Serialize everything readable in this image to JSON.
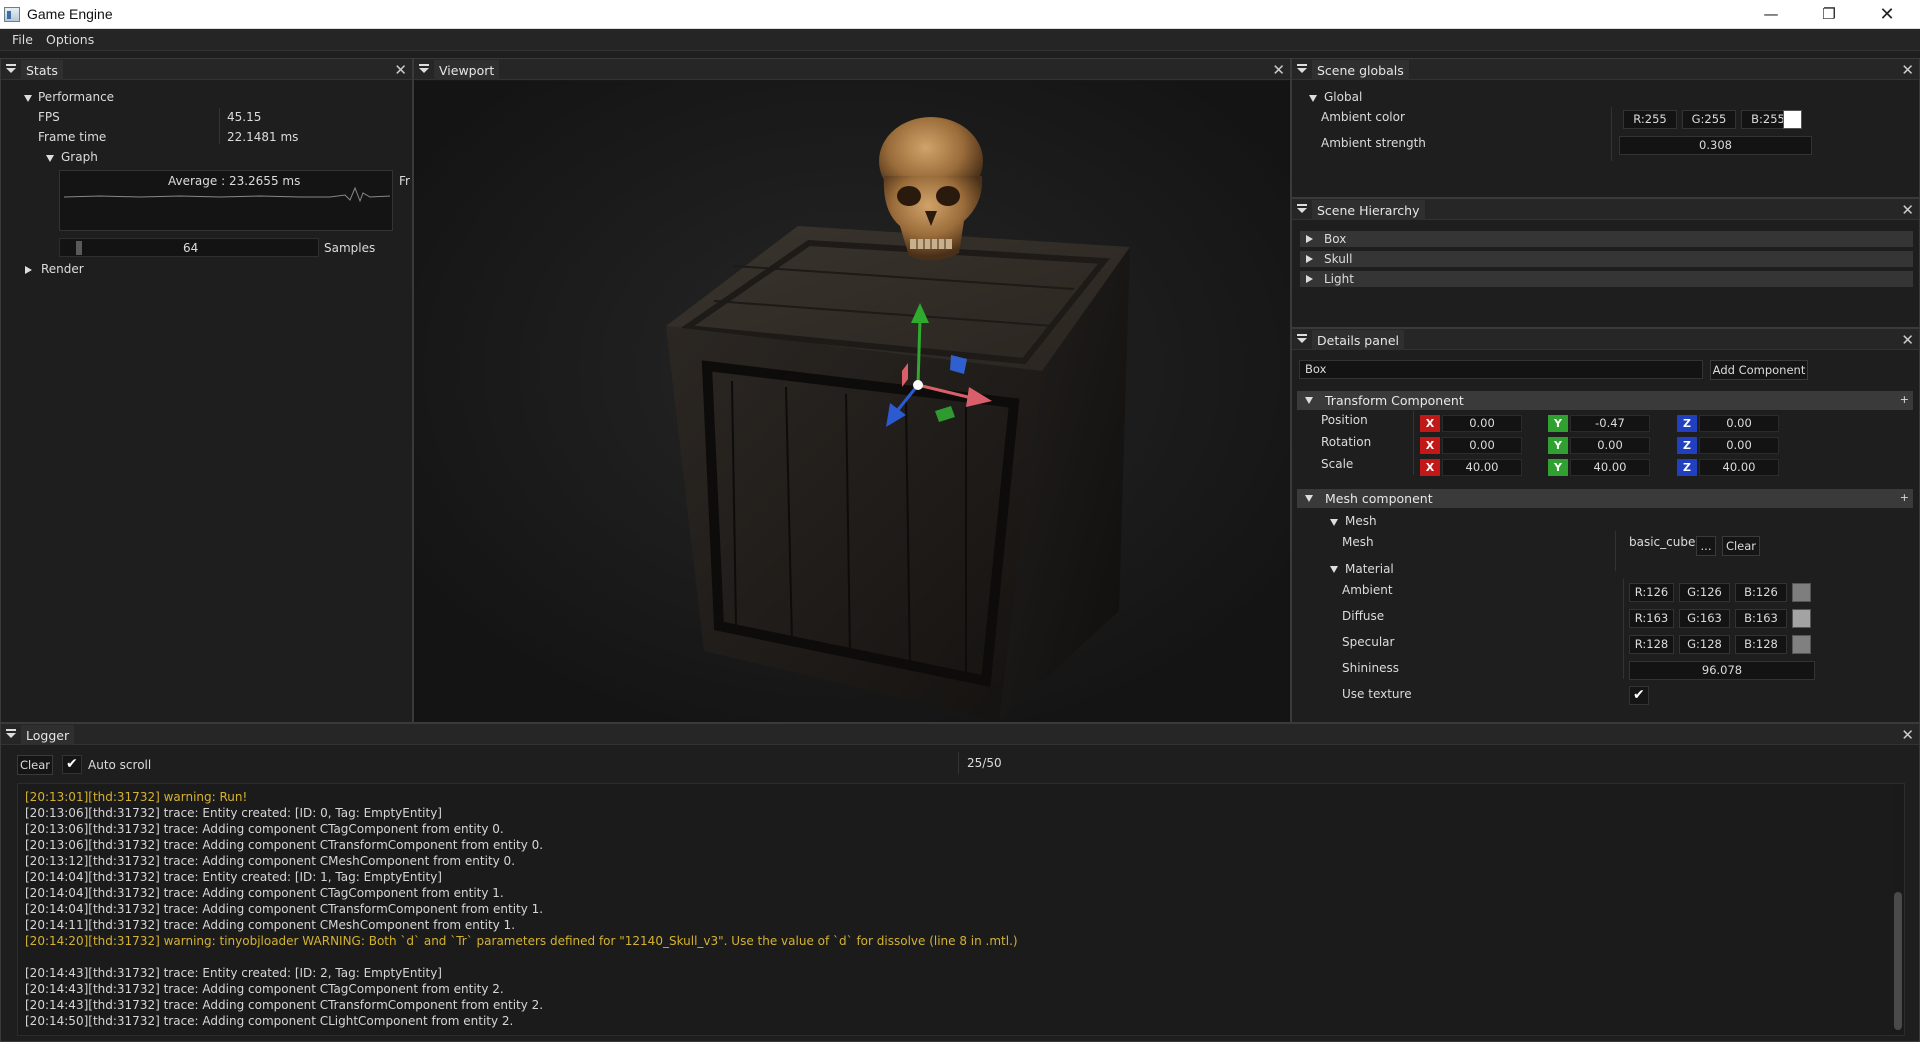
{
  "window": {
    "title": "Game Engine"
  },
  "menu": [
    "File",
    "Options"
  ],
  "stats": {
    "tab": "Stats",
    "performance_label": "Performance",
    "fps_label": "FPS",
    "fps_value": "45.15",
    "frame_time_label": "Frame time",
    "frame_time_value": "22.1481 ms",
    "graph_label": "Graph",
    "graph_average": "Average : 23.2655 ms",
    "graph_side_label": "Fr",
    "samples_value": "64",
    "samples_label": "Samples",
    "render_label": "Render"
  },
  "viewport": {
    "tab": "Viewport"
  },
  "scene_globals": {
    "tab": "Scene globals",
    "global_label": "Global",
    "ambient_color_label": "Ambient color",
    "ambient_r": "R:255",
    "ambient_g": "G:255",
    "ambient_b": "B:255",
    "ambient_swatch": "#ffffff",
    "ambient_strength_label": "Ambient strength",
    "ambient_strength_value": "0.308"
  },
  "hierarchy": {
    "tab": "Scene Hierarchy",
    "items": [
      "Box",
      "Skull",
      "Light"
    ]
  },
  "details": {
    "tab": "Details panel",
    "entity_name": "Box",
    "add_component": "Add Component",
    "transform": {
      "title": "Transform Component",
      "plus": "+",
      "position_label": "Position",
      "rotation_label": "Rotation",
      "scale_label": "Scale",
      "axis_x": "X",
      "axis_y": "Y",
      "axis_z": "Z",
      "position": [
        "0.00",
        "-0.47",
        "0.00"
      ],
      "rotation": [
        "0.00",
        "0.00",
        "0.00"
      ],
      "scale": [
        "40.00",
        "40.00",
        "40.00"
      ]
    },
    "mesh": {
      "title": "Mesh component",
      "plus": "+",
      "mesh_node": "Mesh",
      "mesh_label": "Mesh",
      "mesh_value": "basic_cube",
      "browse": "...",
      "clear": "Clear",
      "material_node": "Material",
      "ambient_label": "Ambient",
      "ambient": [
        "R:126",
        "G:126",
        "B:126"
      ],
      "ambient_swatch": "#7e7e7e",
      "diffuse_label": "Diffuse",
      "diffuse": [
        "R:163",
        "G:163",
        "B:163"
      ],
      "diffuse_swatch": "#a3a3a3",
      "specular_label": "Specular",
      "specular": [
        "R:128",
        "G:128",
        "B:128"
      ],
      "specular_swatch": "#808080",
      "shininess_label": "Shininess",
      "shininess_value": "96.078",
      "use_texture_label": "Use texture",
      "use_texture": true
    }
  },
  "logger": {
    "tab": "Logger",
    "clear": "Clear",
    "auto_scroll": "Auto scroll",
    "counter": "25/50",
    "lines": [
      {
        "type": "warn",
        "text": "[20:13:01][thd:31732] warning: Run!"
      },
      {
        "type": "trace",
        "text": "[20:13:06][thd:31732] trace: Entity created: [ID: 0, Tag: EmptyEntity]"
      },
      {
        "type": "trace",
        "text": "[20:13:06][thd:31732] trace: Adding component CTagComponent from entity 0."
      },
      {
        "type": "trace",
        "text": "[20:13:06][thd:31732] trace: Adding component CTransformComponent from entity 0."
      },
      {
        "type": "trace",
        "text": "[20:13:12][thd:31732] trace: Adding component CMeshComponent from entity 0."
      },
      {
        "type": "trace",
        "text": "[20:14:04][thd:31732] trace: Entity created: [ID: 1, Tag: EmptyEntity]"
      },
      {
        "type": "trace",
        "text": "[20:14:04][thd:31732] trace: Adding component CTagComponent from entity 1."
      },
      {
        "type": "trace",
        "text": "[20:14:04][thd:31732] trace: Adding component CTransformComponent from entity 1."
      },
      {
        "type": "trace",
        "text": "[20:14:11][thd:31732] trace: Adding component CMeshComponent from entity 1."
      },
      {
        "type": "warn",
        "text": "[20:14:20][thd:31732] warning: tinyobjloader WARNING: Both `d` and `Tr` parameters defined for \"12140_Skull_v3\". Use the value of `d` for dissolve (line 8 in .mtl.)"
      },
      {
        "type": "trace",
        "text": ""
      },
      {
        "type": "trace",
        "text": "[20:14:43][thd:31732] trace: Entity created: [ID: 2, Tag: EmptyEntity]"
      },
      {
        "type": "trace",
        "text": "[20:14:43][thd:31732] trace: Adding component CTagComponent from entity 2."
      },
      {
        "type": "trace",
        "text": "[20:14:43][thd:31732] trace: Adding component CTransformComponent from entity 2."
      },
      {
        "type": "trace",
        "text": "[20:14:50][thd:31732] trace: Adding component CLightComponent from entity 2."
      }
    ]
  }
}
